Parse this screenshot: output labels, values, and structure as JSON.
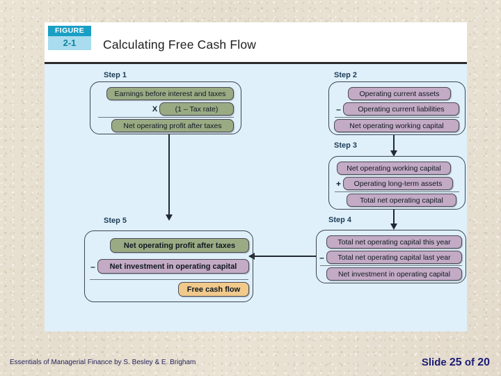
{
  "figure": {
    "badge_word": "FIGURE",
    "badge_number": "2-1",
    "title": "Calculating Free Cash Flow",
    "accent_dark": "#1a9fc4",
    "accent_light": "#a8dcee",
    "panel_bg": "#dff0fb"
  },
  "colors": {
    "green": "#9aab84",
    "purple": "#c3aac5",
    "orange": "#f1c98b",
    "slide_bg": "#e6dece",
    "footer_text": "#1c1c78"
  },
  "steps": {
    "step1": {
      "label": "Step 1",
      "rows": [
        {
          "op": "",
          "text": "Earnings before interest and taxes",
          "color": "green"
        },
        {
          "op": "X",
          "text": "(1 – Tax rate)",
          "color": "green"
        },
        {
          "op": "",
          "text": "Net operating profit after taxes",
          "color": "green"
        }
      ]
    },
    "step2": {
      "label": "Step 2",
      "rows": [
        {
          "op": "",
          "text": "Operating current assets",
          "color": "purple"
        },
        {
          "op": "–",
          "text": "Operating current liabilities",
          "color": "purple"
        },
        {
          "op": "",
          "text": "Net operating working capital",
          "color": "purple"
        }
      ]
    },
    "step3": {
      "label": "Step 3",
      "rows": [
        {
          "op": "",
          "text": "Net operating working capital",
          "color": "purple"
        },
        {
          "op": "+",
          "text": "Operating long-term assets",
          "color": "purple"
        },
        {
          "op": "",
          "text": "Total net operating capital",
          "color": "purple"
        }
      ]
    },
    "step4": {
      "label": "Step 4",
      "rows": [
        {
          "op": "",
          "text": "Total net operating capital this year",
          "color": "purple"
        },
        {
          "op": "–",
          "text": "Total net operating capital last year",
          "color": "purple"
        },
        {
          "op": "",
          "text": "Net investment in operating capital",
          "color": "purple"
        }
      ]
    },
    "step5": {
      "label": "Step 5",
      "rows": [
        {
          "op": "",
          "text": "Net operating profit after taxes",
          "color": "green"
        },
        {
          "op": "–",
          "text": "Net investment in operating capital",
          "color": "purple"
        },
        {
          "op": "",
          "text": "Free cash flow",
          "color": "orange"
        }
      ]
    }
  },
  "footer": {
    "source": "Essentials of Managerial Finance by S. Besley & E. Brigham",
    "slide_prefix": "Slide",
    "slide_current": "25",
    "slide_of": "of",
    "slide_total": "20"
  }
}
